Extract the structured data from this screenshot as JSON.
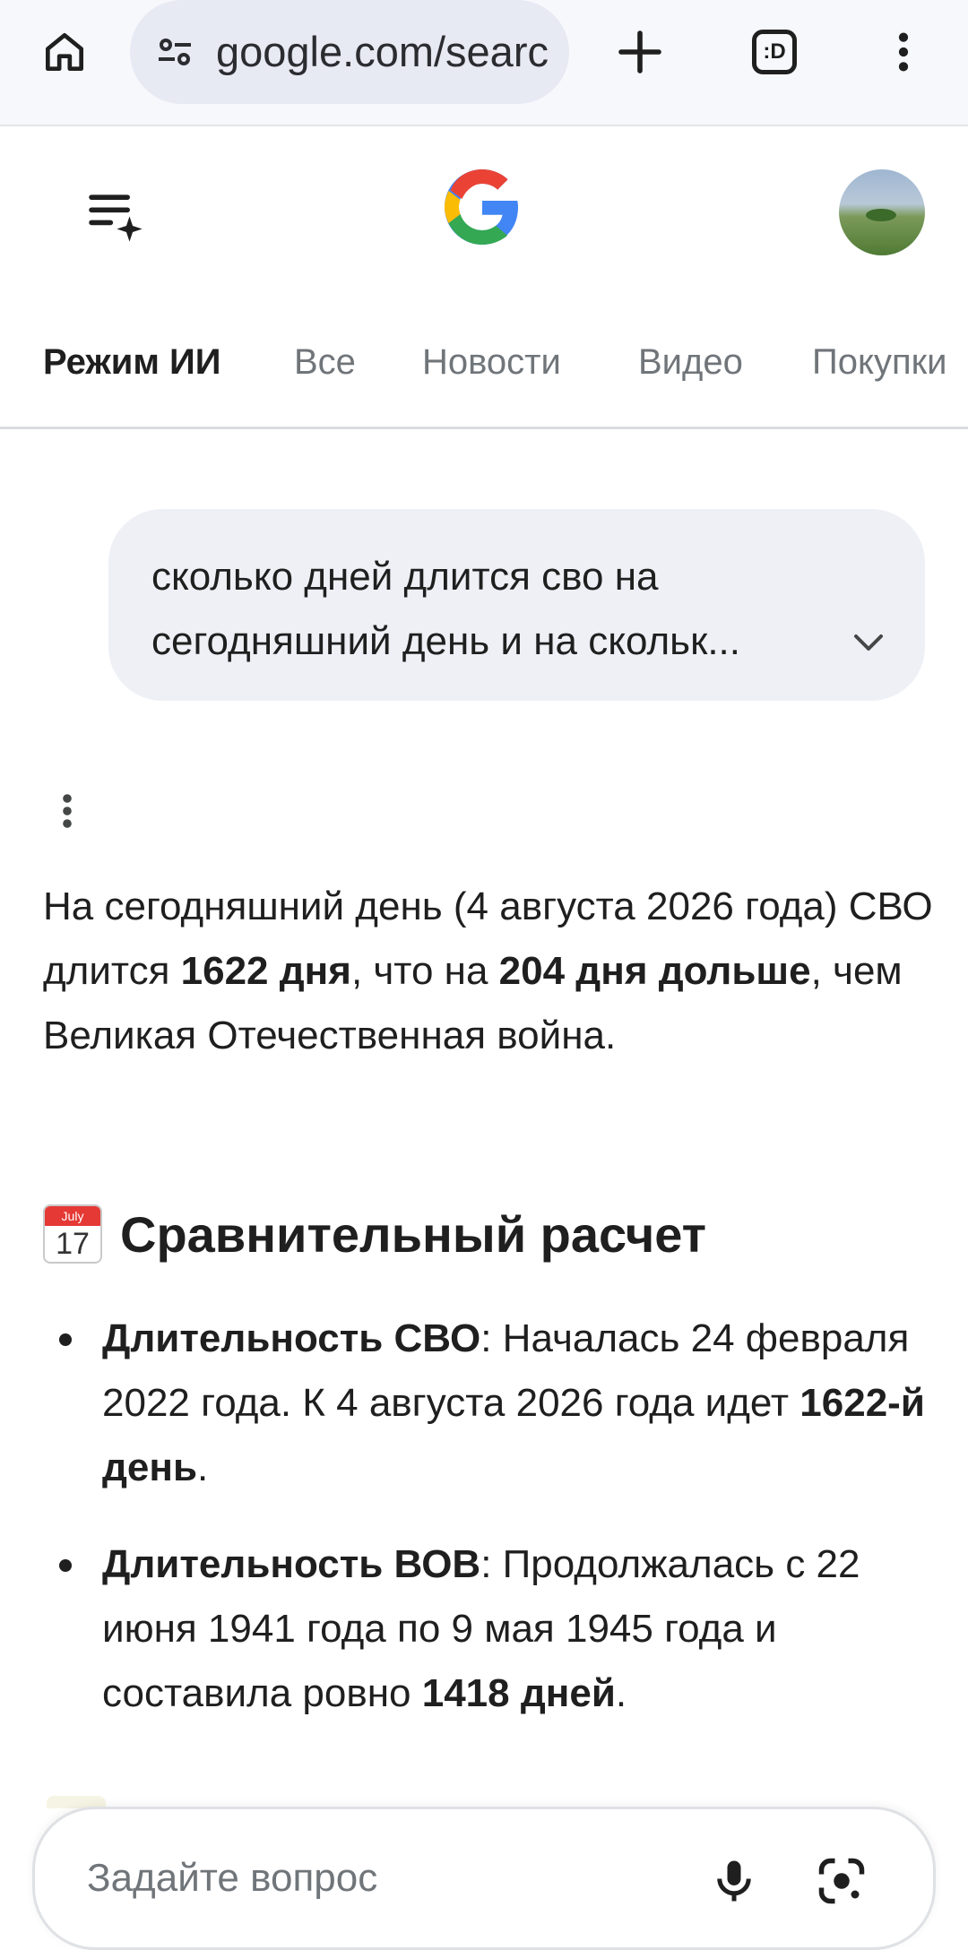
{
  "browser": {
    "url": "google.com/searc",
    "icons": [
      "home-icon",
      "tune-icon",
      "plus-icon",
      "tab-switcher-icon",
      "more-vert-icon"
    ],
    "tab_switcher_text": ":D"
  },
  "header": {
    "icons": [
      "search-history-icon",
      "google-logo",
      "avatar"
    ]
  },
  "tabs": [
    {
      "label": "Режим ИИ",
      "active": true
    },
    {
      "label": "Все"
    },
    {
      "label": "Новости"
    },
    {
      "label": "Видео"
    },
    {
      "label": "Покупки"
    }
  ],
  "query": {
    "line1": "сколько дней длится сво на",
    "line2": "сегодняшний день и на скольк..."
  },
  "answer": {
    "p1_a": "На сегодняшний день (4 августа 2026 года) СВО длится ",
    "p1_b": "1622 дня",
    "p1_c": ", что на ",
    "p1_d": "204 дня дольше",
    "p1_e": ", чем Великая Отечественная война."
  },
  "section": {
    "calendar_month": "July",
    "calendar_day": "17",
    "title": "Сравнительный расчет"
  },
  "bullets": [
    {
      "bold": "Длительность СВО",
      "text": ": Началась 24 февраля 2022 года. К 4 августа 2026 года идет ",
      "bold2": "1622-й день",
      "end": "."
    },
    {
      "bold": "Длительность ВОВ",
      "text": ": Продолжалась с 22 июня 1941 года по 9 мая 1945 года и составила ровно ",
      "bold2": "1418 дней",
      "end": "."
    }
  ],
  "ask": {
    "placeholder": "Задайте вопрос",
    "icons": [
      "mic-icon",
      "lens-icon"
    ]
  },
  "colors": {
    "google_blue": "#4285F4",
    "google_red": "#EA4335",
    "google_yellow": "#FBBC05",
    "google_green": "#34A853"
  }
}
